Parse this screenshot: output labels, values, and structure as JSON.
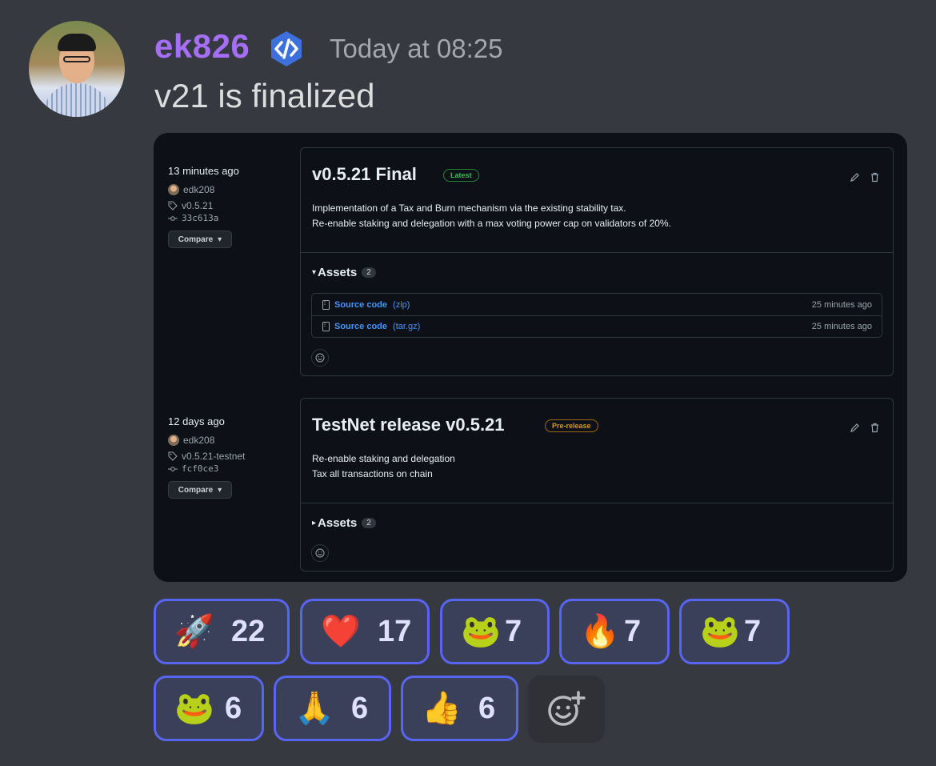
{
  "author": {
    "username": "ek826",
    "badge_icon": "developer-badge-icon",
    "timestamp": "Today at 08:25",
    "name_color": "#a46ef5"
  },
  "message": {
    "text": "v21 is finalized"
  },
  "embed": {
    "releases": [
      {
        "ago": "13 minutes ago",
        "author": "edk208",
        "tag": "v0.5.21",
        "commit": "33c613a",
        "compare_label": "Compare",
        "title": "v0.5.21 Final",
        "label": "Latest",
        "body": [
          "Implementation of a Tax and Burn mechanism via the existing stability tax.",
          "Re-enable staking and delegation with a max voting power cap on validators of 20%."
        ],
        "assets_label": "Assets",
        "assets_count": "2",
        "assets_expanded": true,
        "assets": [
          {
            "name": "Source code",
            "ext": "(zip)",
            "time": "25 minutes ago"
          },
          {
            "name": "Source code",
            "ext": "(tar.gz)",
            "time": "25 minutes ago"
          }
        ]
      },
      {
        "ago": "12 days ago",
        "author": "edk208",
        "tag": "v0.5.21-testnet",
        "commit": "fcf0ce3",
        "compare_label": "Compare",
        "title": "TestNet release v0.5.21",
        "label": "Pre-release",
        "body": [
          "Re-enable staking and delegation",
          "Tax all transactions on chain"
        ],
        "assets_label": "Assets",
        "assets_count": "2",
        "assets_expanded": false
      }
    ]
  },
  "reactions": [
    {
      "emoji": "🚀",
      "count": "22"
    },
    {
      "emoji": "❤️",
      "count": "17"
    },
    {
      "emoji": "🐸",
      "count": "7"
    },
    {
      "emoji": "🔥",
      "count": "7"
    },
    {
      "emoji": "🐸",
      "count": "7"
    },
    {
      "emoji": "🐸",
      "count": "6"
    },
    {
      "emoji": "🙏",
      "count": "6"
    },
    {
      "emoji": "👍",
      "count": "6"
    }
  ],
  "add_reaction_icon": "add-reaction-icon"
}
